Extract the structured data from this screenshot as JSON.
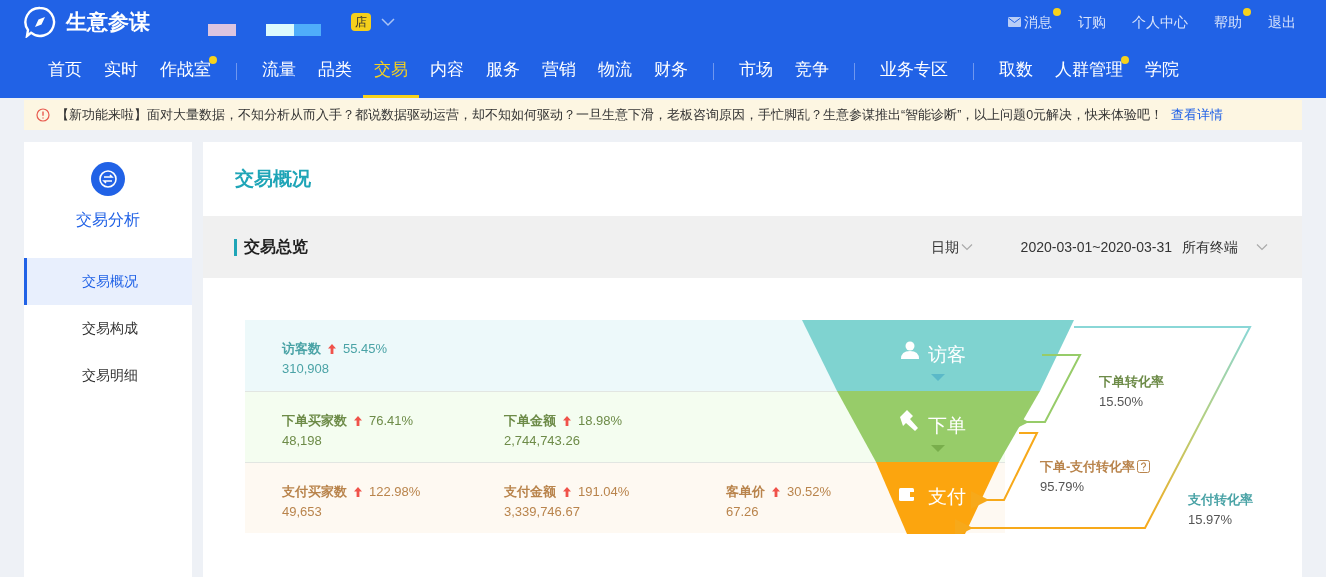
{
  "header": {
    "app_title": "生意参谋",
    "shop_badge": "店",
    "top_links": [
      {
        "label": "消息",
        "kind": "mail",
        "dot": true
      },
      {
        "label": "订购",
        "kind": "plain",
        "dot": false
      },
      {
        "label": "个人中心",
        "kind": "plain",
        "dot": false
      },
      {
        "label": "帮助",
        "kind": "plain",
        "dot": true
      },
      {
        "label": "退出",
        "kind": "plain",
        "dot": false
      }
    ],
    "nav_groups": [
      [
        {
          "label": "首页",
          "selected": false,
          "dot": false
        },
        {
          "label": "实时",
          "selected": false,
          "dot": false
        },
        {
          "label": "作战室",
          "selected": false,
          "dot": true
        }
      ],
      [
        {
          "label": "流量",
          "selected": false,
          "dot": false
        },
        {
          "label": "品类",
          "selected": false,
          "dot": false
        },
        {
          "label": "交易",
          "selected": true,
          "dot": false
        },
        {
          "label": "内容",
          "selected": false,
          "dot": false
        },
        {
          "label": "服务",
          "selected": false,
          "dot": false
        },
        {
          "label": "营销",
          "selected": false,
          "dot": false
        },
        {
          "label": "物流",
          "selected": false,
          "dot": false
        },
        {
          "label": "财务",
          "selected": false,
          "dot": false
        }
      ],
      [
        {
          "label": "市场",
          "selected": false,
          "dot": false
        },
        {
          "label": "竞争",
          "selected": false,
          "dot": false
        }
      ],
      [
        {
          "label": "业务专区",
          "selected": false,
          "dot": false
        }
      ],
      [
        {
          "label": "取数",
          "selected": false,
          "dot": false
        },
        {
          "label": "人群管理",
          "selected": false,
          "dot": true
        },
        {
          "label": "学院",
          "selected": false,
          "dot": false
        }
      ]
    ]
  },
  "notice": {
    "text": "【新功能来啦】面对大量数据，不知分析从而入手？都说数据驱动运营，却不知如何驱动？一旦生意下滑，老板咨询原因，手忙脚乱？生意参谋推出“智能诊断”，以上问题0元解决，快来体验吧！",
    "link": "查看详情"
  },
  "sidebar": {
    "title": "交易分析",
    "items": [
      {
        "label": "交易概况",
        "selected": true
      },
      {
        "label": "交易构成",
        "selected": false
      },
      {
        "label": "交易明细",
        "selected": false
      }
    ]
  },
  "main": {
    "title": "交易概况",
    "section_title": "交易总览",
    "date_label": "日期",
    "date_range": "2020-03-01~2020-03-31",
    "terminal": "所有终端"
  },
  "funnel": {
    "rows": [
      {
        "kind": "visitor",
        "stage": "访客",
        "metrics": [
          {
            "label": "访客数",
            "change": "55.45%",
            "value": "310,908"
          }
        ]
      },
      {
        "kind": "order",
        "stage": "下单",
        "metrics": [
          {
            "label": "下单买家数",
            "change": "76.41%",
            "value": "48,198"
          },
          {
            "label": "下单金额",
            "change": "18.98%",
            "value": "2,744,743.26"
          }
        ]
      },
      {
        "kind": "pay",
        "stage": "支付",
        "metrics": [
          {
            "label": "支付买家数",
            "change": "122.98%",
            "value": "49,653"
          },
          {
            "label": "支付金额",
            "change": "191.04%",
            "value": "3,339,746.67"
          },
          {
            "label": "客单价",
            "change": "30.52%",
            "value": "67.26"
          }
        ]
      }
    ],
    "conversions": [
      {
        "kind": "order",
        "label": "下单转化率",
        "value": "15.50%",
        "help": false
      },
      {
        "kind": "order_pay",
        "label": "下单-支付转化率",
        "value": "95.79%",
        "help": true
      },
      {
        "kind": "pay",
        "label": "支付转化率",
        "value": "15.97%",
        "help": false
      }
    ]
  }
}
